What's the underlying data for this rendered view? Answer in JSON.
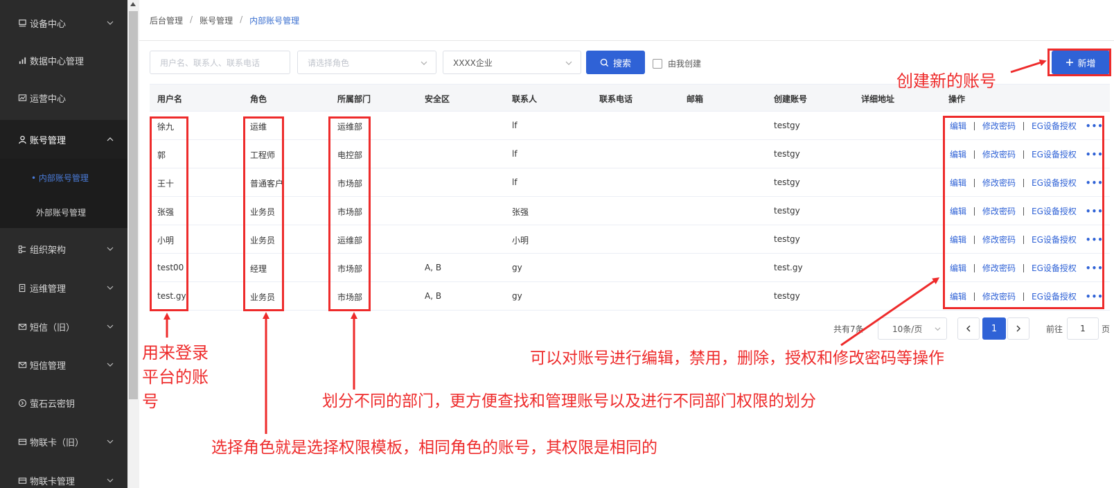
{
  "sidebar": {
    "items": [
      {
        "label": "设备中心",
        "icon": "device-icon"
      },
      {
        "label": "数据中心管理",
        "icon": "chart-icon"
      },
      {
        "label": "运营中心",
        "icon": "monitor-chart-icon"
      },
      {
        "label": "账号管理",
        "icon": "user-icon"
      },
      {
        "label": "组织架构",
        "icon": "org-icon"
      },
      {
        "label": "运维管理",
        "icon": "document-icon"
      },
      {
        "label": "短信（旧）",
        "icon": "mail-icon"
      },
      {
        "label": "短信管理",
        "icon": "mail-icon"
      },
      {
        "label": "萤石云密钥",
        "icon": "key-circle-icon"
      },
      {
        "label": "物联卡（旧）",
        "icon": "card-icon"
      },
      {
        "label": "物联卡管理",
        "icon": "card-icon"
      }
    ],
    "sub_items": [
      {
        "label": "• 内部账号管理"
      },
      {
        "label": "外部账号管理"
      }
    ]
  },
  "breadcrumb": {
    "items": [
      "后台管理",
      "账号管理",
      "内部账号管理"
    ],
    "sep": "/"
  },
  "filters": {
    "keyword_placeholder": "用户名、联系人、联系电话",
    "role_placeholder": "请选择角色",
    "enterprise_value": "XXXX企业",
    "search_label": "搜索",
    "created_by_me_label": "由我创建",
    "add_label": "新增"
  },
  "table": {
    "columns": [
      "用户名",
      "角色",
      "所属部门",
      "安全区",
      "联系人",
      "联系电话",
      "邮箱",
      "创建账号",
      "详细地址",
      "操作"
    ],
    "rows": [
      {
        "username": "徐九",
        "role": "运维",
        "dept": "运维部",
        "zone": "",
        "contact": "lf",
        "phone": "",
        "email": "",
        "creator": "testgy",
        "address": ""
      },
      {
        "username": "郭",
        "role": "工程师",
        "dept": "电控部",
        "zone": "",
        "contact": "lf",
        "phone": "",
        "email": "",
        "creator": "testgy",
        "address": ""
      },
      {
        "username": "王十",
        "role": "普通客户",
        "dept": "市场部",
        "zone": "",
        "contact": "lf",
        "phone": "",
        "email": "",
        "creator": "testgy",
        "address": ""
      },
      {
        "username": "张强",
        "role": "业务员",
        "dept": "市场部",
        "zone": "",
        "contact": "张强",
        "phone": "",
        "email": "",
        "creator": "testgy",
        "address": ""
      },
      {
        "username": "小明",
        "role": "业务员",
        "dept": "运维部",
        "zone": "",
        "contact": "小明",
        "phone": "",
        "email": "",
        "creator": "testgy",
        "address": ""
      },
      {
        "username": "test00",
        "role": "经理",
        "dept": "市场部",
        "zone": "A, B",
        "contact": "gy",
        "phone": "",
        "email": "",
        "creator": "test.gy",
        "address": ""
      },
      {
        "username": "test.gy",
        "role": "业务员",
        "dept": "市场部",
        "zone": "A, B",
        "contact": "gy",
        "phone": "",
        "email": "",
        "creator": "testgy",
        "address": ""
      }
    ],
    "ops": {
      "edit": "编辑",
      "change_password": "修改密码",
      "authorize": "EG设备授权",
      "more": "•••"
    }
  },
  "pagination": {
    "total_text": "共有7条",
    "page_size": "10条/页",
    "current_page": "1",
    "goto_label": "前往",
    "goto_value": "1",
    "goto_suffix": "页"
  },
  "annotations": {
    "add_account": "创建新的账号",
    "username_line1": "用来登录",
    "username_line2": "平台的账",
    "username_line3": "号",
    "dept": "划分不同的部门，更方便查找和管理账号以及进行不同部门权限的划分",
    "role": "选择角色就是选择权限模板，相同角色的账号，其权限是相同的",
    "ops": "可以对账号进行编辑，禁用，删除，授权和修改密码等操作"
  },
  "colors": {
    "sidebar_bg": "#2b2b2b",
    "primary": "#2f62d6",
    "annotation_red": "#ee2b2b"
  }
}
